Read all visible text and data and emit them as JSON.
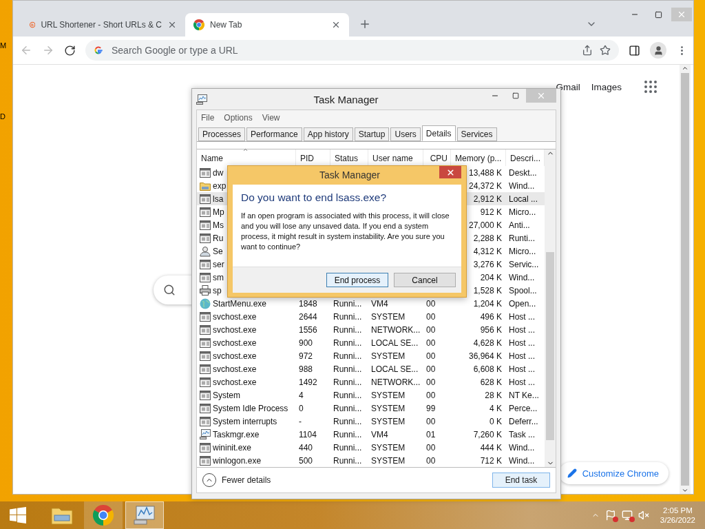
{
  "desktop_labels": [
    "M",
    "D"
  ],
  "browser": {
    "tabs": [
      {
        "title": "URL Shortener - Short URLs & C",
        "selected": false,
        "kind": "bitly"
      },
      {
        "title": "New Tab",
        "selected": true,
        "kind": "chrome"
      }
    ],
    "omnibox": {
      "placeholder": "Search Google or type a URL"
    },
    "links": [
      "Gmail",
      "Images"
    ],
    "customize_button": "Customize Chrome"
  },
  "task_manager": {
    "title": "Task Manager",
    "menu": [
      "File",
      "Options",
      "View"
    ],
    "tabs": [
      {
        "label": "Processes",
        "selected": false
      },
      {
        "label": "Performance",
        "selected": false
      },
      {
        "label": "App history",
        "selected": false
      },
      {
        "label": "Startup",
        "selected": false
      },
      {
        "label": "Users",
        "selected": false
      },
      {
        "label": "Details",
        "selected": true
      },
      {
        "label": "Services",
        "selected": false
      }
    ],
    "columns": [
      "Name",
      "PID",
      "Status",
      "User name",
      "CPU",
      "Memory (p...",
      "Descri..."
    ],
    "rows": [
      {
        "kind": "app",
        "name": "dw",
        "memory": "13,488 K",
        "description": "Deskt...",
        "selected": false
      },
      {
        "kind": "folder",
        "name": "exp",
        "memory": "24,372 K",
        "description": "Wind...",
        "selected": false
      },
      {
        "kind": "app",
        "name": "lsa",
        "memory": "2,912 K",
        "description": "Local ...",
        "selected": true
      },
      {
        "kind": "app",
        "name": "Mp",
        "memory": "912 K",
        "description": "Micro...",
        "selected": false
      },
      {
        "kind": "app",
        "name": "Ms",
        "memory": "27,000 K",
        "description": "Anti...",
        "selected": false
      },
      {
        "kind": "app",
        "name": "Ru",
        "memory": "2,288 K",
        "description": "Runti...",
        "selected": false
      },
      {
        "kind": "user",
        "name": "Se",
        "memory": "4,312 K",
        "description": "Micro...",
        "selected": false
      },
      {
        "kind": "app",
        "name": "ser",
        "memory": "3,276 K",
        "description": "Servic...",
        "selected": false
      },
      {
        "kind": "app",
        "name": "sm",
        "memory": "204 K",
        "description": "Wind...",
        "selected": false
      },
      {
        "kind": "printer",
        "name": "sp",
        "memory": "1,528 K",
        "description": "Spool...",
        "selected": false
      },
      {
        "kind": "globe",
        "name": "StartMenu.exe",
        "pid": "1848",
        "status": "Runni...",
        "user": "VM4",
        "cpu": "00",
        "memory": "1,204 K",
        "description": "Open...",
        "selected": false
      },
      {
        "kind": "app",
        "name": "svchost.exe",
        "pid": "2644",
        "status": "Runni...",
        "user": "SYSTEM",
        "cpu": "00",
        "memory": "496 K",
        "description": "Host ...",
        "selected": false
      },
      {
        "kind": "app",
        "name": "svchost.exe",
        "pid": "1556",
        "status": "Runni...",
        "user": "NETWORK...",
        "cpu": "00",
        "memory": "956 K",
        "description": "Host ...",
        "selected": false
      },
      {
        "kind": "app",
        "name": "svchost.exe",
        "pid": "900",
        "status": "Runni...",
        "user": "LOCAL SE...",
        "cpu": "00",
        "memory": "4,628 K",
        "description": "Host ...",
        "selected": false
      },
      {
        "kind": "app",
        "name": "svchost.exe",
        "pid": "972",
        "status": "Runni...",
        "user": "SYSTEM",
        "cpu": "00",
        "memory": "36,964 K",
        "description": "Host ...",
        "selected": false
      },
      {
        "kind": "app",
        "name": "svchost.exe",
        "pid": "988",
        "status": "Runni...",
        "user": "LOCAL SE...",
        "cpu": "00",
        "memory": "6,608 K",
        "description": "Host ...",
        "selected": false
      },
      {
        "kind": "app",
        "name": "svchost.exe",
        "pid": "1492",
        "status": "Runni...",
        "user": "NETWORK...",
        "cpu": "00",
        "memory": "628 K",
        "description": "Host ...",
        "selected": false
      },
      {
        "kind": "app",
        "name": "System",
        "pid": "4",
        "status": "Runni...",
        "user": "SYSTEM",
        "cpu": "00",
        "memory": "28 K",
        "description": "NT Ke...",
        "selected": false
      },
      {
        "kind": "app",
        "name": "System Idle Process",
        "pid": "0",
        "status": "Runni...",
        "user": "SYSTEM",
        "cpu": "99",
        "memory": "4 K",
        "description": "Perce...",
        "selected": false
      },
      {
        "kind": "app",
        "name": "System interrupts",
        "pid": "-",
        "status": "Runni...",
        "user": "SYSTEM",
        "cpu": "00",
        "memory": "0 K",
        "description": "Deferr...",
        "selected": false
      },
      {
        "kind": "monitor",
        "name": "Taskmgr.exe",
        "pid": "1104",
        "status": "Runni...",
        "user": "VM4",
        "cpu": "01",
        "memory": "7,260 K",
        "description": "Task ...",
        "selected": false
      },
      {
        "kind": "app",
        "name": "wininit.exe",
        "pid": "440",
        "status": "Runni...",
        "user": "SYSTEM",
        "cpu": "00",
        "memory": "444 K",
        "description": "Wind...",
        "selected": false
      },
      {
        "kind": "app",
        "name": "winlogon.exe",
        "pid": "500",
        "status": "Runni...",
        "user": "SYSTEM",
        "cpu": "00",
        "memory": "712 K",
        "description": "Wind...",
        "selected": false
      }
    ],
    "footer": {
      "toggle": "Fewer details",
      "button": "End task"
    }
  },
  "dialog": {
    "title": "Task Manager",
    "heading": "Do you want to end lsass.exe?",
    "message": "If an open program is associated with this process, it will close and you will lose any unsaved data. If you end a system process, it might result in system instability. Are you sure you want to continue?",
    "buttons": [
      {
        "label": "End process",
        "default": true
      },
      {
        "label": "Cancel",
        "default": false
      }
    ]
  },
  "taskbar": {
    "apps": [
      {
        "kind": "explorer"
      },
      {
        "kind": "chrome"
      },
      {
        "kind": "taskmgr"
      }
    ],
    "time": "2:05 PM",
    "date": "3/26/2022"
  }
}
